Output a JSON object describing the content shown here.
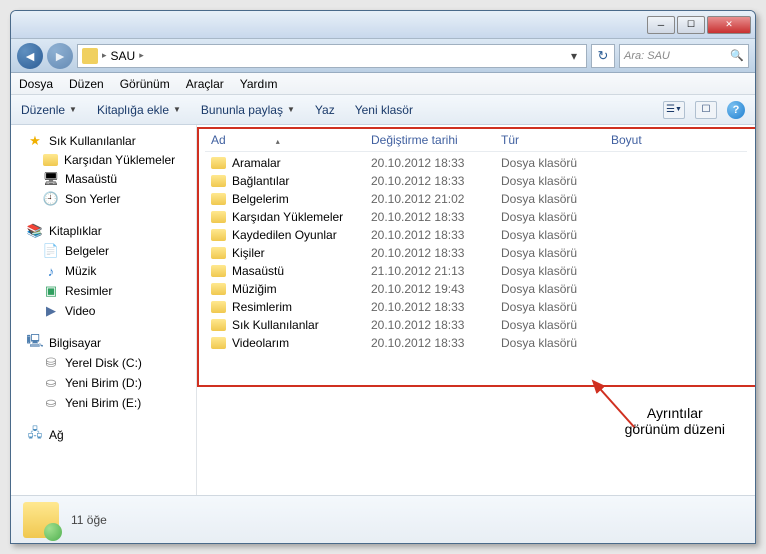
{
  "breadcrumb": {
    "folder": "SAU"
  },
  "search": {
    "placeholder": "Ara: SAU"
  },
  "menu": {
    "file": "Dosya",
    "edit": "Düzen",
    "view": "Görünüm",
    "tools": "Araçlar",
    "help": "Yardım"
  },
  "toolbar": {
    "organize": "Düzenle",
    "library": "Kitaplığa ekle",
    "share": "Bununla paylaş",
    "write": "Yaz",
    "newfolder": "Yeni klasör"
  },
  "sidebar": {
    "favorites": {
      "label": "Sık Kullanılanlar",
      "items": [
        "Karşıdan Yüklemeler",
        "Masaüstü",
        "Son Yerler"
      ]
    },
    "libraries": {
      "label": "Kitaplıklar",
      "items": [
        "Belgeler",
        "Müzik",
        "Resimler",
        "Video"
      ]
    },
    "computer": {
      "label": "Bilgisayar",
      "items": [
        "Yerel Disk (C:)",
        "Yeni Birim (D:)",
        "Yeni Birim (E:)"
      ]
    },
    "network": {
      "label": "Ağ"
    }
  },
  "columns": {
    "name": "Ad",
    "date": "Değiştirme tarihi",
    "type": "Tür",
    "size": "Boyut"
  },
  "files": [
    {
      "name": "Aramalar",
      "date": "20.10.2012 18:33",
      "type": "Dosya klasörü"
    },
    {
      "name": "Bağlantılar",
      "date": "20.10.2012 18:33",
      "type": "Dosya klasörü"
    },
    {
      "name": "Belgelerim",
      "date": "20.10.2012 21:02",
      "type": "Dosya klasörü"
    },
    {
      "name": "Karşıdan Yüklemeler",
      "date": "20.10.2012 18:33",
      "type": "Dosya klasörü"
    },
    {
      "name": "Kaydedilen Oyunlar",
      "date": "20.10.2012 18:33",
      "type": "Dosya klasörü"
    },
    {
      "name": "Kişiler",
      "date": "20.10.2012 18:33",
      "type": "Dosya klasörü"
    },
    {
      "name": "Masaüstü",
      "date": "21.10.2012 21:13",
      "type": "Dosya klasörü"
    },
    {
      "name": "Müziğim",
      "date": "20.10.2012 19:43",
      "type": "Dosya klasörü"
    },
    {
      "name": "Resimlerim",
      "date": "20.10.2012 18:33",
      "type": "Dosya klasörü"
    },
    {
      "name": "Sık Kullanılanlar",
      "date": "20.10.2012 18:33",
      "type": "Dosya klasörü"
    },
    {
      "name": "Videolarım",
      "date": "20.10.2012 18:33",
      "type": "Dosya klasörü"
    }
  ],
  "annotation": {
    "line1": "Ayrıntılar",
    "line2": "görünüm düzeni"
  },
  "status": {
    "count": "11 öğe"
  }
}
